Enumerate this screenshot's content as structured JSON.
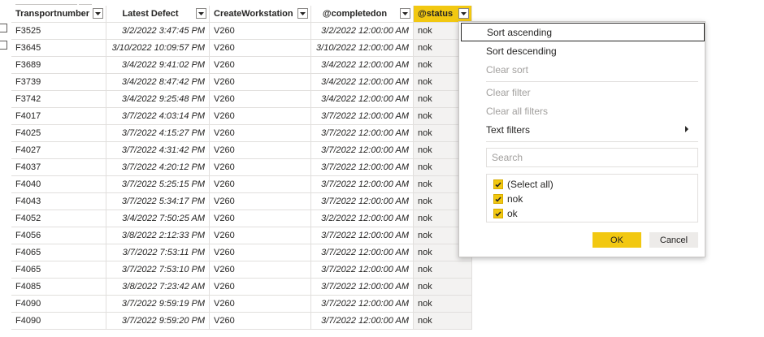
{
  "table": {
    "columns": [
      {
        "label": "Transportnumber"
      },
      {
        "label": "Latest Defect"
      },
      {
        "label": "CreateWorkstation"
      },
      {
        "label": "@completedon"
      },
      {
        "label": "@status"
      }
    ],
    "rows": [
      [
        "F3525",
        "3/2/2022 3:47:45 PM",
        "V260",
        "3/2/2022 12:00:00 AM",
        "nok"
      ],
      [
        "F3645",
        "3/10/2022 10:09:57 PM",
        "V260",
        "3/10/2022 12:00:00 AM",
        "nok"
      ],
      [
        "F3689",
        "3/4/2022 9:41:02 PM",
        "V260",
        "3/4/2022 12:00:00 AM",
        "nok"
      ],
      [
        "F3739",
        "3/4/2022 8:47:42 PM",
        "V260",
        "3/4/2022 12:00:00 AM",
        "nok"
      ],
      [
        "F3742",
        "3/4/2022 9:25:48 PM",
        "V260",
        "3/4/2022 12:00:00 AM",
        "nok"
      ],
      [
        "F4017",
        "3/7/2022 4:03:14 PM",
        "V260",
        "3/7/2022 12:00:00 AM",
        "nok"
      ],
      [
        "F4025",
        "3/7/2022 4:15:27 PM",
        "V260",
        "3/7/2022 12:00:00 AM",
        "nok"
      ],
      [
        "F4027",
        "3/7/2022 4:31:42 PM",
        "V260",
        "3/7/2022 12:00:00 AM",
        "nok"
      ],
      [
        "F4037",
        "3/7/2022 4:20:12 PM",
        "V260",
        "3/7/2022 12:00:00 AM",
        "nok"
      ],
      [
        "F4040",
        "3/7/2022 5:25:15 PM",
        "V260",
        "3/7/2022 12:00:00 AM",
        "nok"
      ],
      [
        "F4043",
        "3/7/2022 5:34:17 PM",
        "V260",
        "3/7/2022 12:00:00 AM",
        "nok"
      ],
      [
        "F4052",
        "3/4/2022 7:50:25 AM",
        "V260",
        "3/2/2022 12:00:00 AM",
        "nok"
      ],
      [
        "F4056",
        "3/8/2022 2:12:33 PM",
        "V260",
        "3/7/2022 12:00:00 AM",
        "nok"
      ],
      [
        "F4065",
        "3/7/2022 7:53:11 PM",
        "V260",
        "3/7/2022 12:00:00 AM",
        "nok"
      ],
      [
        "F4065",
        "3/7/2022 7:53:10 PM",
        "V260",
        "3/7/2022 12:00:00 AM",
        "nok"
      ],
      [
        "F4085",
        "3/8/2022 7:23:42 AM",
        "V260",
        "3/7/2022 12:00:00 AM",
        "nok"
      ],
      [
        "F4090",
        "3/7/2022 9:59:19 PM",
        "V260",
        "3/7/2022 12:00:00 AM",
        "nok"
      ],
      [
        "F4090",
        "3/7/2022 9:59:20 PM",
        "V260",
        "3/7/2022 12:00:00 AM",
        "nok"
      ]
    ]
  },
  "filter_menu": {
    "sort_ascending": "Sort ascending",
    "sort_descending": "Sort descending",
    "clear_sort": "Clear sort",
    "clear_filter": "Clear filter",
    "clear_all_filters": "Clear all filters",
    "text_filters": "Text filters",
    "search_placeholder": "Search",
    "options": [
      {
        "label": "(Select all)",
        "checked": true
      },
      {
        "label": "nok",
        "checked": true
      },
      {
        "label": "ok",
        "checked": true
      }
    ],
    "ok_label": "OK",
    "cancel_label": "Cancel"
  },
  "colors": {
    "accent": "#f2c811",
    "grid_line": "#e1dfdd",
    "disabled_text": "#a19f9d"
  },
  "icons": {
    "column_dropdown": "chevron-down-icon",
    "submenu": "chevron-right-icon",
    "checkbox": "check-icon"
  }
}
